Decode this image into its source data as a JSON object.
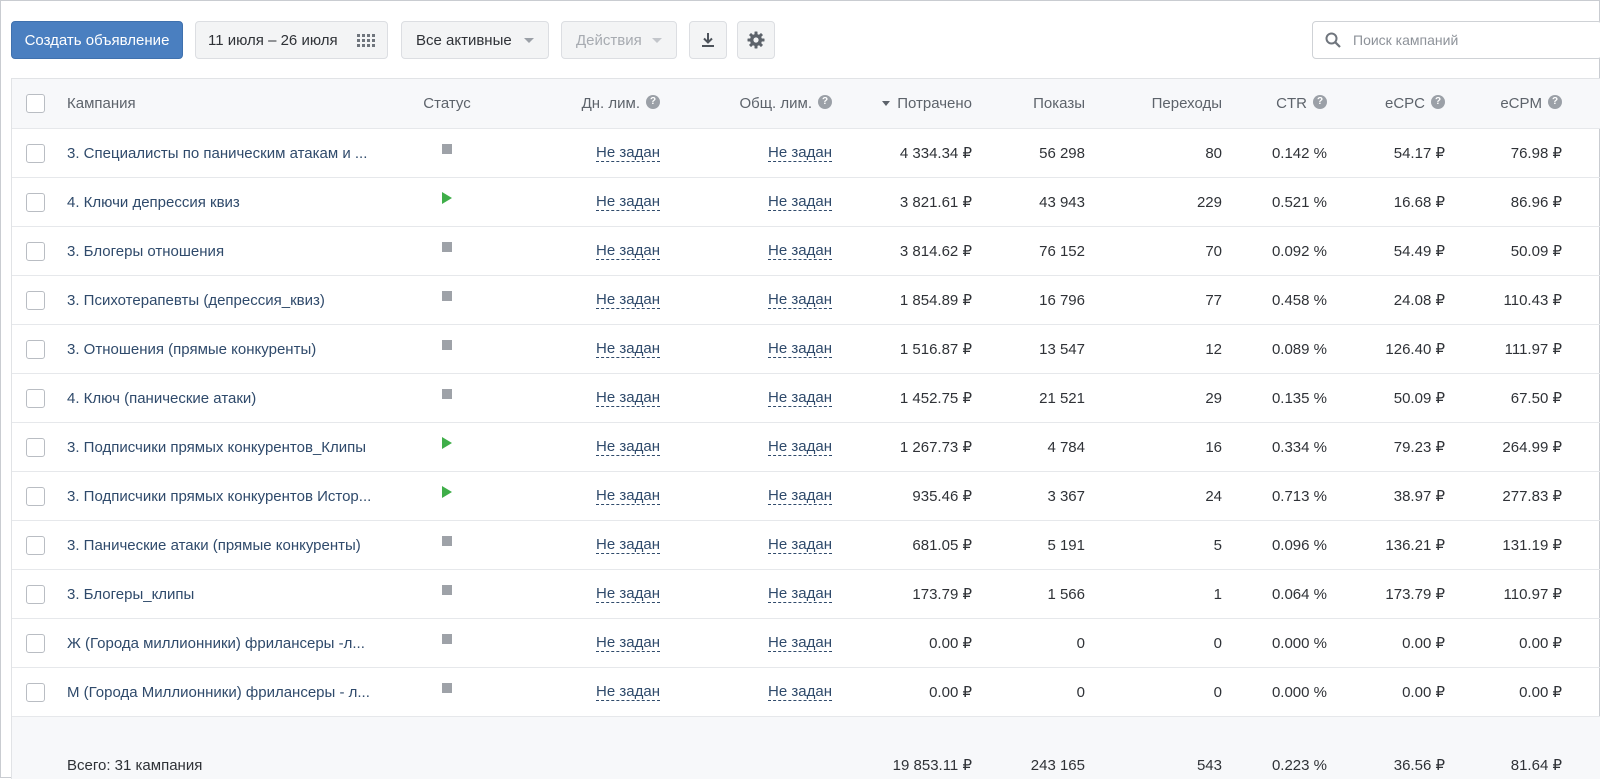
{
  "toolbar": {
    "create_label": "Создать объявление",
    "date_range": "11 июля – 26 июля",
    "filter_label": "Все активные",
    "actions_label": "Действия"
  },
  "search": {
    "placeholder": "Поиск кампаний"
  },
  "icons": {
    "calendar": "calendar-grid-icon",
    "download": "download-icon",
    "settings": "gear-icon",
    "search": "search-icon",
    "status_stopped": "stop-square-icon",
    "status_active": "play-triangle-icon",
    "help": "question-circle-icon"
  },
  "colors": {
    "primary": "#4a7fc0",
    "active_status": "#3fae49",
    "stopped_status": "#9ea2a8",
    "link": "#2f4a6b"
  },
  "table": {
    "headers": {
      "campaign": "Кампания",
      "status": "Статус",
      "daily_limit": "Дн. лим.",
      "total_limit": "Общ. лим.",
      "spent": "Потрачено",
      "impressions": "Показы",
      "clicks": "Переходы",
      "ctr": "CTR",
      "ecpc": "eCPC",
      "ecpm": "eCPM"
    },
    "rows": [
      {
        "name": "3. Специалисты по паническим атакам и ...",
        "status": "stopped",
        "daily": "Не задан",
        "total": "Не задан",
        "spent": "4 334.34 ₽",
        "impressions": "56 298",
        "clicks": "80",
        "ctr": "0.142 %",
        "ecpc": "54.17 ₽",
        "ecpm": "76.98 ₽"
      },
      {
        "name": "4. Ключи депрессия квиз",
        "status": "active",
        "daily": "Не задан",
        "total": "Не задан",
        "spent": "3 821.61 ₽",
        "impressions": "43 943",
        "clicks": "229",
        "ctr": "0.521 %",
        "ecpc": "16.68 ₽",
        "ecpm": "86.96 ₽"
      },
      {
        "name": "3. Блогеры отношения",
        "status": "stopped",
        "daily": "Не задан",
        "total": "Не задан",
        "spent": "3 814.62 ₽",
        "impressions": "76 152",
        "clicks": "70",
        "ctr": "0.092 %",
        "ecpc": "54.49 ₽",
        "ecpm": "50.09 ₽"
      },
      {
        "name": "3. Психотерапевты (депрессия_квиз)",
        "status": "stopped",
        "daily": "Не задан",
        "total": "Не задан",
        "spent": "1 854.89 ₽",
        "impressions": "16 796",
        "clicks": "77",
        "ctr": "0.458 %",
        "ecpc": "24.08 ₽",
        "ecpm": "110.43 ₽"
      },
      {
        "name": "3. Отношения (прямые конкуренты)",
        "status": "stopped",
        "daily": "Не задан",
        "total": "Не задан",
        "spent": "1 516.87 ₽",
        "impressions": "13 547",
        "clicks": "12",
        "ctr": "0.089 %",
        "ecpc": "126.40 ₽",
        "ecpm": "111.97 ₽"
      },
      {
        "name": "4. Ключ (панические атаки)",
        "status": "stopped",
        "daily": "Не задан",
        "total": "Не задан",
        "spent": "1 452.75 ₽",
        "impressions": "21 521",
        "clicks": "29",
        "ctr": "0.135 %",
        "ecpc": "50.09 ₽",
        "ecpm": "67.50 ₽"
      },
      {
        "name": "3. Подписчики прямых конкурентов_Клипы",
        "status": "active",
        "daily": "Не задан",
        "total": "Не задан",
        "spent": "1 267.73 ₽",
        "impressions": "4 784",
        "clicks": "16",
        "ctr": "0.334 %",
        "ecpc": "79.23 ₽",
        "ecpm": "264.99 ₽"
      },
      {
        "name": "3. Подписчики прямых конкурентов Истор...",
        "status": "active",
        "daily": "Не задан",
        "total": "Не задан",
        "spent": "935.46 ₽",
        "impressions": "3 367",
        "clicks": "24",
        "ctr": "0.713 %",
        "ecpc": "38.97 ₽",
        "ecpm": "277.83 ₽"
      },
      {
        "name": "3. Панические атаки (прямые конкуренты)",
        "status": "stopped",
        "daily": "Не задан",
        "total": "Не задан",
        "spent": "681.05 ₽",
        "impressions": "5 191",
        "clicks": "5",
        "ctr": "0.096 %",
        "ecpc": "136.21 ₽",
        "ecpm": "131.19 ₽"
      },
      {
        "name": "3. Блогеры_клипы",
        "status": "stopped",
        "daily": "Не задан",
        "total": "Не задан",
        "spent": "173.79 ₽",
        "impressions": "1 566",
        "clicks": "1",
        "ctr": "0.064 %",
        "ecpc": "173.79 ₽",
        "ecpm": "110.97 ₽"
      },
      {
        "name": "Ж (Города миллионники) фрилансеры -л...",
        "status": "stopped",
        "daily": "Не задан",
        "total": "Не задан",
        "spent": "0.00 ₽",
        "impressions": "0",
        "clicks": "0",
        "ctr": "0.000 %",
        "ecpc": "0.00 ₽",
        "ecpm": "0.00 ₽"
      },
      {
        "name": "М (Города Миллионники) фрилансеры - л...",
        "status": "stopped",
        "daily": "Не задан",
        "total": "Не задан",
        "spent": "0.00 ₽",
        "impressions": "0",
        "clicks": "0",
        "ctr": "0.000 %",
        "ecpc": "0.00 ₽",
        "ecpm": "0.00 ₽"
      }
    ],
    "total": {
      "label": "Всего: 31 кампания",
      "spent": "19 853.11 ₽",
      "impressions": "243 165",
      "clicks": "543",
      "ctr": "0.223 %",
      "ecpc": "36.56 ₽",
      "ecpm": "81.64 ₽"
    }
  }
}
